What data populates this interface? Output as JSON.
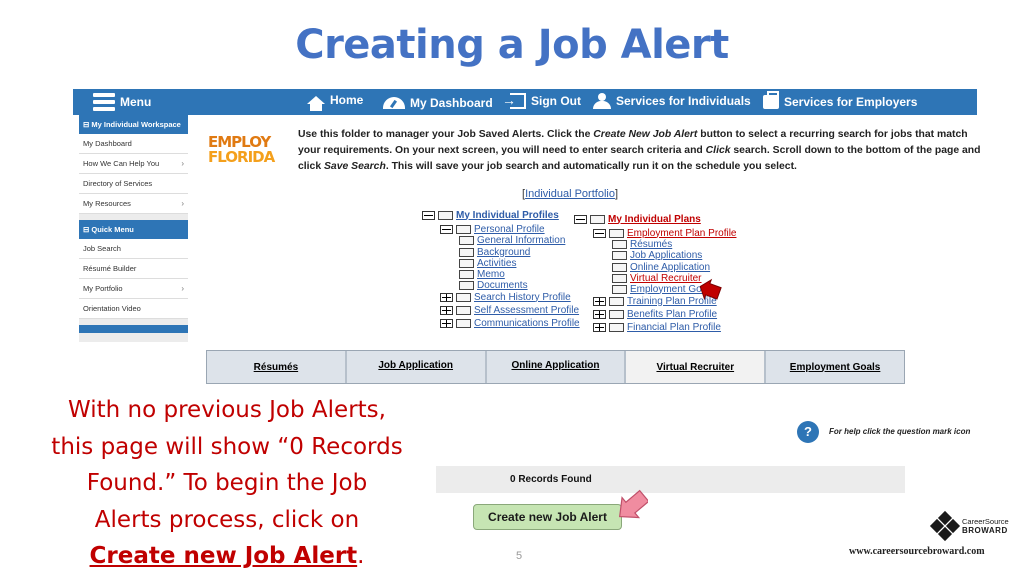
{
  "slide": {
    "title": "Creating a Job Alert",
    "caption_lines": [
      "With no previous Job Alerts,",
      "this page will show “0 Records",
      "Found.”  To begin the Job",
      "Alerts process, click on"
    ],
    "caption_link": "Create new Job Alert",
    "caption_end": ".",
    "page_number": "5",
    "brand_line1": "CareerSource",
    "brand_line2": "BROWARD",
    "site_url": "www.careersourcebroward.com"
  },
  "navbar": {
    "menu": "Menu",
    "home": "Home",
    "dashboard": "My Dashboard",
    "signout": "Sign Out",
    "individuals": "Services for Individuals",
    "employers": "Services for Employers"
  },
  "sidemenu": {
    "header1": "My Individual Workspace",
    "items1": [
      "My Dashboard",
      "How We Can Help You",
      "Directory of Services",
      "My Resources"
    ],
    "header2": "Quick Menu",
    "items2": [
      "Job Search",
      "Résumé Builder",
      "My Portfolio",
      "Orientation Video"
    ]
  },
  "logo": {
    "line1": "EMPLOY",
    "line2": "FLORIDA"
  },
  "intro": {
    "part1": "Use this folder to manager your Job Saved Alerts. Click the ",
    "em1": "Create New Job Alert",
    "part2": " button to select a recurring search for jobs that match your requirements. On your next screen, you will need to enter search criteria and ",
    "em2": "Click",
    "part3": " search. Scroll down to the bottom of the page and click ",
    "em3": "Save Search",
    "part4": ". This will save your job search and automatically run it on the schedule you select."
  },
  "portfolio": {
    "link": "Individual Portfolio"
  },
  "tree": {
    "profiles_title": "My Individual Profiles",
    "profiles": [
      "Personal Profile",
      "General Information",
      "Background",
      "Activities",
      "Memo",
      "Documents",
      "Search History Profile",
      "Self Assessment Profile",
      "Communications Profile"
    ],
    "plans_title": "My Individual Plans",
    "plans": [
      "Employment Plan Profile",
      "Résumés",
      "Job Applications",
      "Online Application",
      "Virtual Recruiter",
      "Employment Goals",
      "Training Plan Profile",
      "Benefits Plan Profile",
      "Financial Plan Profile"
    ]
  },
  "tabs": [
    "Résumés",
    "Job Application",
    "Online Application",
    "Virtual Recruiter",
    "Employment Goals"
  ],
  "help": {
    "icon": "?",
    "text": "For help click the question mark icon"
  },
  "records": {
    "text": "0 Records Found"
  },
  "create_button": {
    "label": "Create new Job Alert"
  },
  "colors": {
    "title": "#4472c4",
    "navbar": "#2e75b6",
    "caption": "#c00000",
    "button": "#c6e5b3"
  }
}
